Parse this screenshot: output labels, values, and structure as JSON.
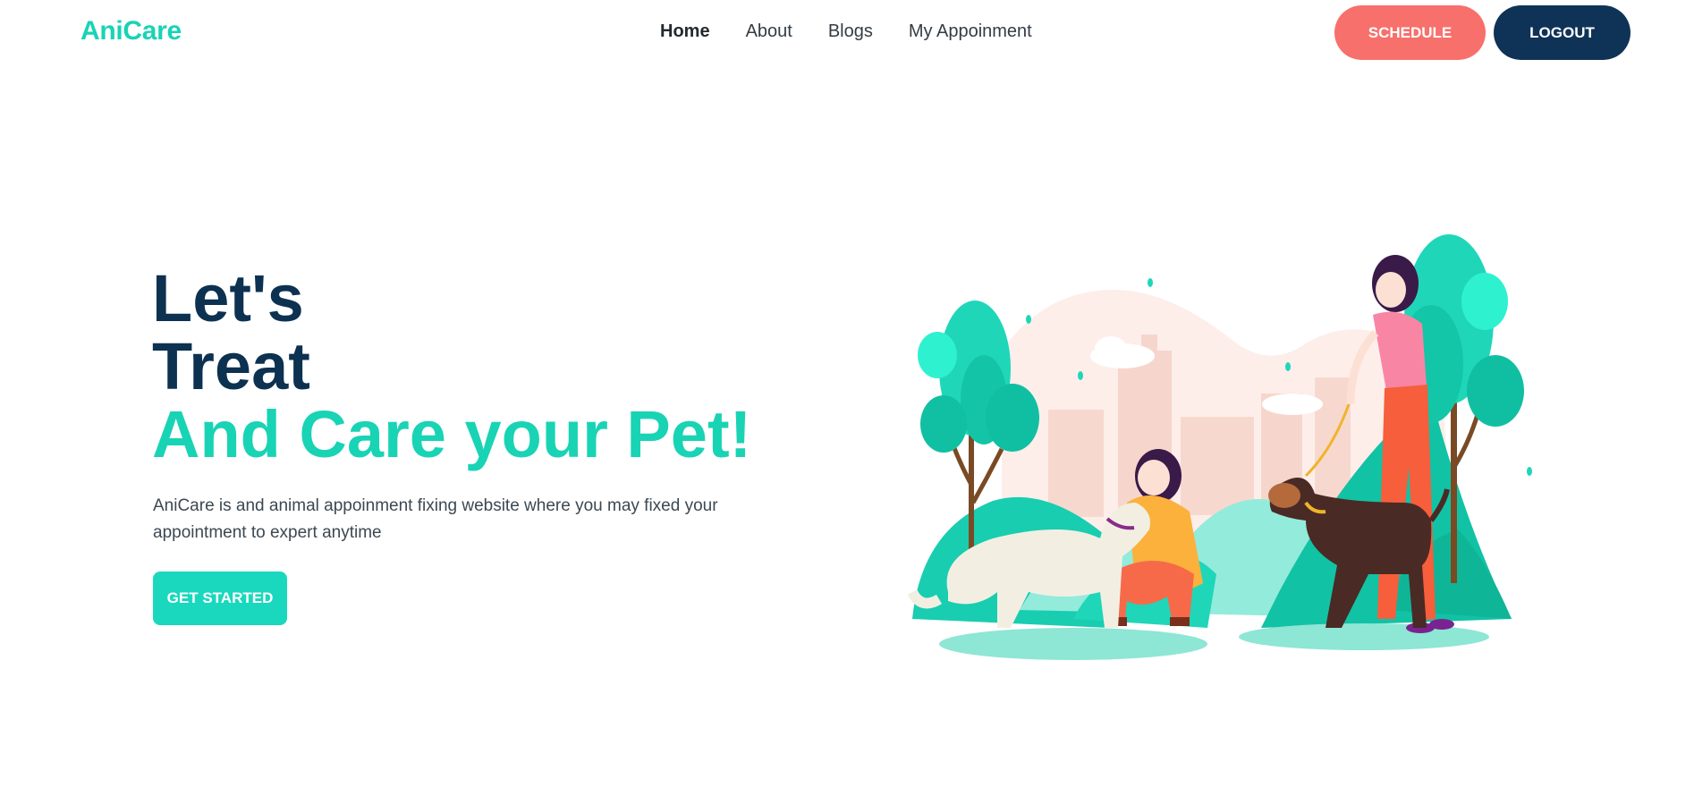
{
  "navbar": {
    "brand": "AniCare",
    "links": [
      {
        "label": "Home",
        "active": true
      },
      {
        "label": "About",
        "active": false
      },
      {
        "label": "Blogs",
        "active": false
      },
      {
        "label": "My Appoinment",
        "active": false
      }
    ],
    "schedule_label": "SCHEDULE",
    "logout_label": "LOGOUT"
  },
  "hero": {
    "title_lines": [
      "Let's",
      "Treat",
      "And Care your Pet!"
    ],
    "description": "AniCare is and animal appoinment fixing website where you may fixed your appointment to expert anytime",
    "cta_label": "GET STARTED"
  },
  "colors": {
    "accent": "#19d3b5",
    "navy": "#0f3356",
    "coral": "#f7706b",
    "text": "#3c4852"
  }
}
